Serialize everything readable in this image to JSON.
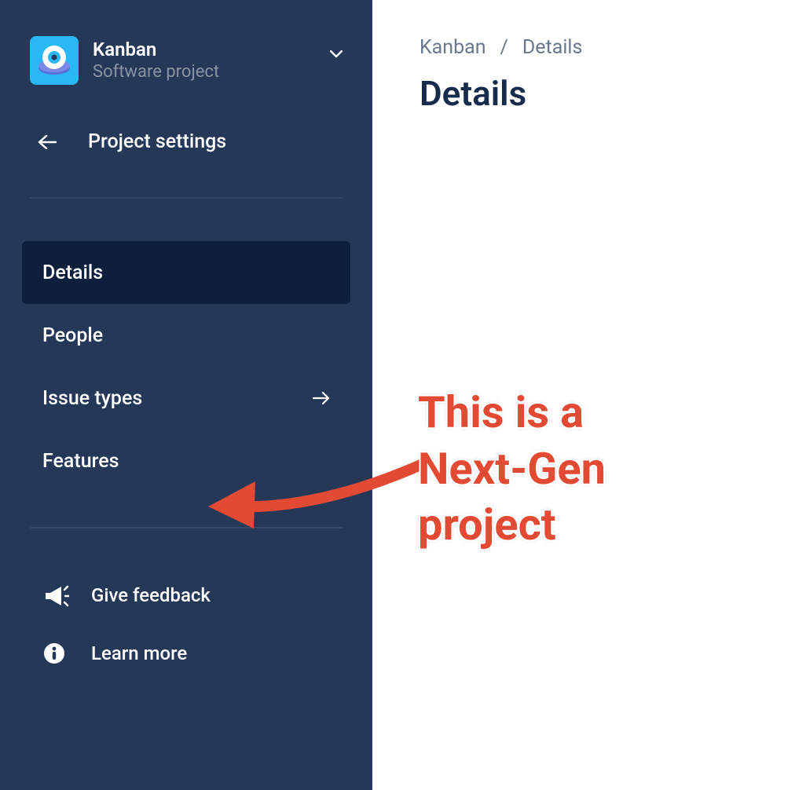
{
  "sidebar": {
    "project_name": "Kanban",
    "project_type": "Software project",
    "back_label": "Project settings",
    "nav": [
      {
        "label": "Details",
        "active": true,
        "has_arrow": false
      },
      {
        "label": "People",
        "active": false,
        "has_arrow": false
      },
      {
        "label": "Issue types",
        "active": false,
        "has_arrow": true
      },
      {
        "label": "Features",
        "active": false,
        "has_arrow": false
      }
    ],
    "bottom": {
      "feedback": "Give feedback",
      "learn": "Learn more"
    }
  },
  "breadcrumb": {
    "root": "Kanban",
    "separator": "/",
    "current": "Details"
  },
  "page": {
    "title": "Details"
  },
  "annotation": {
    "text": "This is a\nNext-Gen\nproject",
    "color": "#E34A33"
  }
}
